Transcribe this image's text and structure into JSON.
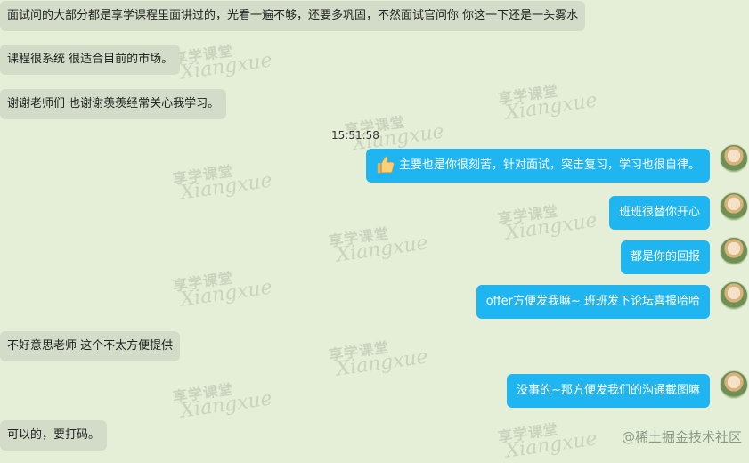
{
  "messages": [
    {
      "side": "left",
      "text": "面试问的大部分都是享学课程里面讲过的，光看一遍不够，还要多巩固，不然面试官问你 你这一下还是一头雾水"
    },
    {
      "side": "left",
      "text": "课程很系统 很适合目前的市场。"
    },
    {
      "side": "left",
      "text": "谢谢老师们 也谢谢羡羡经常关心我学习。"
    },
    {
      "side": "right",
      "text": "主要也是你很刻苦，针对面试，突击复习，学习也很自律。",
      "icon": "thumbs-up-icon"
    },
    {
      "side": "right",
      "text": "班班很替你开心"
    },
    {
      "side": "right",
      "text": "都是你的回报"
    },
    {
      "side": "right",
      "text": "offer方便发我嘛~ 班班发下论坛喜报哈哈"
    },
    {
      "side": "left",
      "text": "不好意思老师 这个不太方便提供"
    },
    {
      "side": "right",
      "text": "没事的~那方便发我们的沟通截图嘛"
    },
    {
      "side": "left",
      "text": "可以的，要打码。"
    }
  ],
  "timestamp": "15:51:58",
  "watermark": {
    "cn": "享学课堂",
    "en": "Xiangxue"
  },
  "footer": "@稀土掘金技术社区"
}
